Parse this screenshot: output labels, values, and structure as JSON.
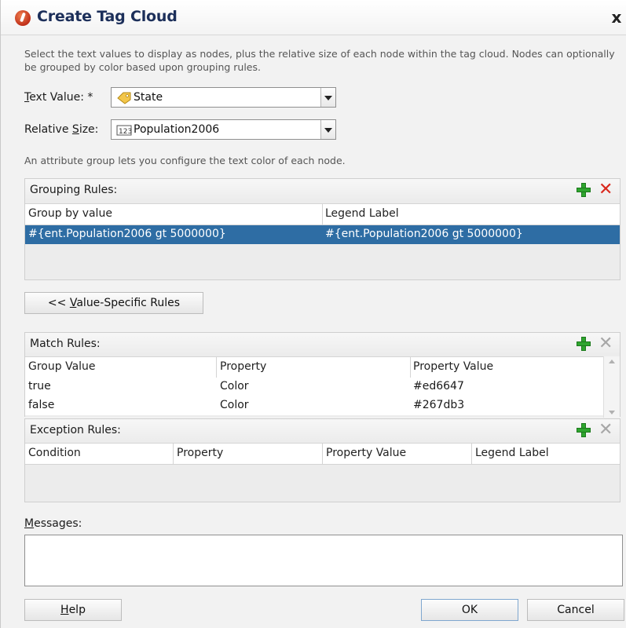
{
  "title": "Create Tag Cloud",
  "close_label": "x",
  "description": "Select the text values to display as nodes, plus the relative size of each node within the tag cloud. Nodes can optionally be grouped by color based upon grouping rules.",
  "text_value": {
    "label": "Text Value: *",
    "value": "State",
    "icon": "tag-icon"
  },
  "relative_size": {
    "label": "Relative Size:",
    "value": "Population2006",
    "icon": "numeric-attribute-icon"
  },
  "attribute_hint": "An attribute group lets you configure the text color of each node.",
  "grouping_rules": {
    "title": "Grouping Rules:",
    "columns": [
      "Group by value",
      "Legend Label"
    ],
    "rows": [
      {
        "group_by": "#{ent.Population2006 gt 5000000}",
        "legend": "#{ent.Population2006 gt 5000000}",
        "selected": true
      }
    ]
  },
  "value_specific_button": "<< Value-Specific Rules",
  "match_rules": {
    "title": "Match Rules:",
    "columns": [
      "Group Value",
      "Property",
      "Property Value"
    ],
    "rows": [
      {
        "group_value": "true",
        "property": "Color",
        "property_value": "#ed6647"
      },
      {
        "group_value": "false",
        "property": "Color",
        "property_value": "#267db3"
      }
    ]
  },
  "exception_rules": {
    "title": "Exception Rules:",
    "columns": [
      "Condition",
      "Property",
      "Property Value",
      "Legend Label"
    ]
  },
  "messages_label": "Messages:",
  "buttons": {
    "help": "Help",
    "ok": "OK",
    "cancel": "Cancel"
  },
  "colors": {
    "selection": "#2e6da4",
    "title_text": "#1c2f5a",
    "add": "#2fa52f",
    "delete": "#d9281d"
  }
}
